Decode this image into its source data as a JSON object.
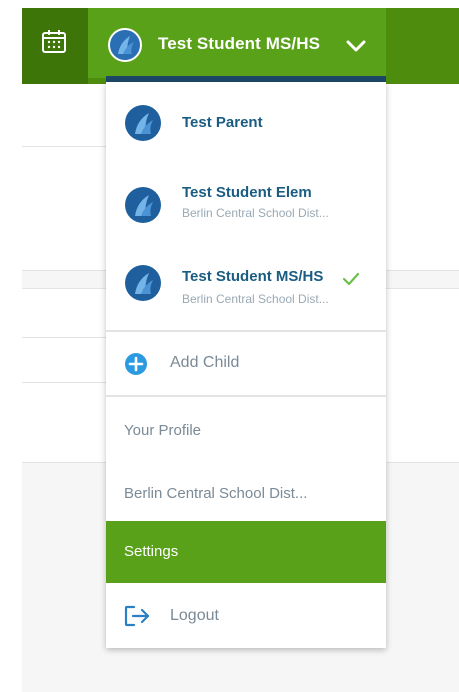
{
  "header": {
    "user_name": "Test Student MS/HS"
  },
  "dropdown": {
    "accounts": [
      {
        "name": "Test Parent",
        "subtitle": ""
      },
      {
        "name": "Test Student Elem",
        "subtitle": "Berlin Central School Dist..."
      },
      {
        "name": "Test Student MS/HS",
        "subtitle": "Berlin Central School Dist...",
        "selected": true
      }
    ],
    "add_child": "Add Child",
    "your_profile": "Your Profile",
    "district": "Berlin Central School Dist...",
    "settings": "Settings",
    "logout": "Logout"
  },
  "colors": {
    "header_green": "#4e8c0e",
    "active_green": "#5aa11a",
    "navy": "#1c4867",
    "link_blue": "#1b5d82",
    "check_green": "#6cc04a"
  }
}
